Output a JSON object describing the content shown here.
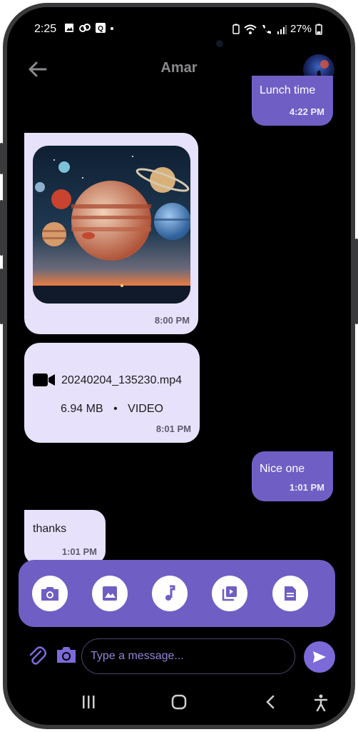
{
  "status_bar": {
    "time": "2:25",
    "battery": "27%"
  },
  "header": {
    "title": "Amar"
  },
  "messages": [
    {
      "text": "Lunch time",
      "time": "4:22 PM"
    },
    {
      "time": "8:00 PM"
    },
    {
      "file_name": "20240204_135230.mp4",
      "file_size": "6.94 MB",
      "separator": "•",
      "file_type": "VIDEO",
      "time": "8:01 PM"
    },
    {
      "text": "Nice one",
      "time": "1:01 PM"
    },
    {
      "text": "thanks",
      "time": "1:01 PM"
    }
  ],
  "attachment_tray": {
    "items": [
      "camera-icon",
      "image-icon",
      "music-icon",
      "video-library-icon",
      "document-icon"
    ]
  },
  "composer": {
    "placeholder": "Type a message..."
  },
  "colors": {
    "accent": "#6f5fc4",
    "incoming_bubble": "#e7e1fb",
    "background": "#000000"
  }
}
